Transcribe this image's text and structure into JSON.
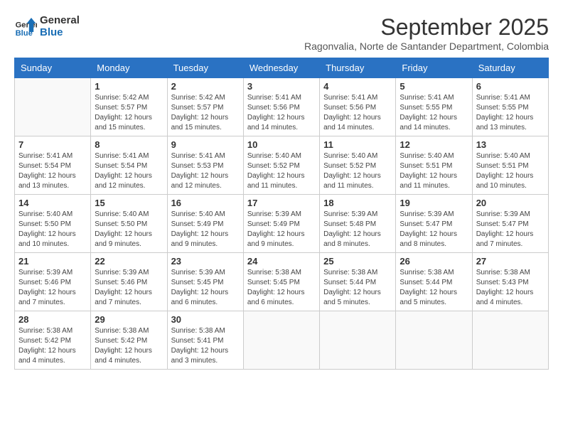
{
  "logo": {
    "line1": "General",
    "line2": "Blue"
  },
  "title": "September 2025",
  "subtitle": "Ragonvalia, Norte de Santander Department, Colombia",
  "headers": [
    "Sunday",
    "Monday",
    "Tuesday",
    "Wednesday",
    "Thursday",
    "Friday",
    "Saturday"
  ],
  "weeks": [
    [
      {
        "num": "",
        "info": ""
      },
      {
        "num": "1",
        "info": "Sunrise: 5:42 AM\nSunset: 5:57 PM\nDaylight: 12 hours\nand 15 minutes."
      },
      {
        "num": "2",
        "info": "Sunrise: 5:42 AM\nSunset: 5:57 PM\nDaylight: 12 hours\nand 15 minutes."
      },
      {
        "num": "3",
        "info": "Sunrise: 5:41 AM\nSunset: 5:56 PM\nDaylight: 12 hours\nand 14 minutes."
      },
      {
        "num": "4",
        "info": "Sunrise: 5:41 AM\nSunset: 5:56 PM\nDaylight: 12 hours\nand 14 minutes."
      },
      {
        "num": "5",
        "info": "Sunrise: 5:41 AM\nSunset: 5:55 PM\nDaylight: 12 hours\nand 14 minutes."
      },
      {
        "num": "6",
        "info": "Sunrise: 5:41 AM\nSunset: 5:55 PM\nDaylight: 12 hours\nand 13 minutes."
      }
    ],
    [
      {
        "num": "7",
        "info": "Sunrise: 5:41 AM\nSunset: 5:54 PM\nDaylight: 12 hours\nand 13 minutes."
      },
      {
        "num": "8",
        "info": "Sunrise: 5:41 AM\nSunset: 5:54 PM\nDaylight: 12 hours\nand 12 minutes."
      },
      {
        "num": "9",
        "info": "Sunrise: 5:41 AM\nSunset: 5:53 PM\nDaylight: 12 hours\nand 12 minutes."
      },
      {
        "num": "10",
        "info": "Sunrise: 5:40 AM\nSunset: 5:52 PM\nDaylight: 12 hours\nand 11 minutes."
      },
      {
        "num": "11",
        "info": "Sunrise: 5:40 AM\nSunset: 5:52 PM\nDaylight: 12 hours\nand 11 minutes."
      },
      {
        "num": "12",
        "info": "Sunrise: 5:40 AM\nSunset: 5:51 PM\nDaylight: 12 hours\nand 11 minutes."
      },
      {
        "num": "13",
        "info": "Sunrise: 5:40 AM\nSunset: 5:51 PM\nDaylight: 12 hours\nand 10 minutes."
      }
    ],
    [
      {
        "num": "14",
        "info": "Sunrise: 5:40 AM\nSunset: 5:50 PM\nDaylight: 12 hours\nand 10 minutes."
      },
      {
        "num": "15",
        "info": "Sunrise: 5:40 AM\nSunset: 5:50 PM\nDaylight: 12 hours\nand 9 minutes."
      },
      {
        "num": "16",
        "info": "Sunrise: 5:40 AM\nSunset: 5:49 PM\nDaylight: 12 hours\nand 9 minutes."
      },
      {
        "num": "17",
        "info": "Sunrise: 5:39 AM\nSunset: 5:49 PM\nDaylight: 12 hours\nand 9 minutes."
      },
      {
        "num": "18",
        "info": "Sunrise: 5:39 AM\nSunset: 5:48 PM\nDaylight: 12 hours\nand 8 minutes."
      },
      {
        "num": "19",
        "info": "Sunrise: 5:39 AM\nSunset: 5:47 PM\nDaylight: 12 hours\nand 8 minutes."
      },
      {
        "num": "20",
        "info": "Sunrise: 5:39 AM\nSunset: 5:47 PM\nDaylight: 12 hours\nand 7 minutes."
      }
    ],
    [
      {
        "num": "21",
        "info": "Sunrise: 5:39 AM\nSunset: 5:46 PM\nDaylight: 12 hours\nand 7 minutes."
      },
      {
        "num": "22",
        "info": "Sunrise: 5:39 AM\nSunset: 5:46 PM\nDaylight: 12 hours\nand 7 minutes."
      },
      {
        "num": "23",
        "info": "Sunrise: 5:39 AM\nSunset: 5:45 PM\nDaylight: 12 hours\nand 6 minutes."
      },
      {
        "num": "24",
        "info": "Sunrise: 5:38 AM\nSunset: 5:45 PM\nDaylight: 12 hours\nand 6 minutes."
      },
      {
        "num": "25",
        "info": "Sunrise: 5:38 AM\nSunset: 5:44 PM\nDaylight: 12 hours\nand 5 minutes."
      },
      {
        "num": "26",
        "info": "Sunrise: 5:38 AM\nSunset: 5:44 PM\nDaylight: 12 hours\nand 5 minutes."
      },
      {
        "num": "27",
        "info": "Sunrise: 5:38 AM\nSunset: 5:43 PM\nDaylight: 12 hours\nand 4 minutes."
      }
    ],
    [
      {
        "num": "28",
        "info": "Sunrise: 5:38 AM\nSunset: 5:42 PM\nDaylight: 12 hours\nand 4 minutes."
      },
      {
        "num": "29",
        "info": "Sunrise: 5:38 AM\nSunset: 5:42 PM\nDaylight: 12 hours\nand 4 minutes."
      },
      {
        "num": "30",
        "info": "Sunrise: 5:38 AM\nSunset: 5:41 PM\nDaylight: 12 hours\nand 3 minutes."
      },
      {
        "num": "",
        "info": ""
      },
      {
        "num": "",
        "info": ""
      },
      {
        "num": "",
        "info": ""
      },
      {
        "num": "",
        "info": ""
      }
    ]
  ]
}
